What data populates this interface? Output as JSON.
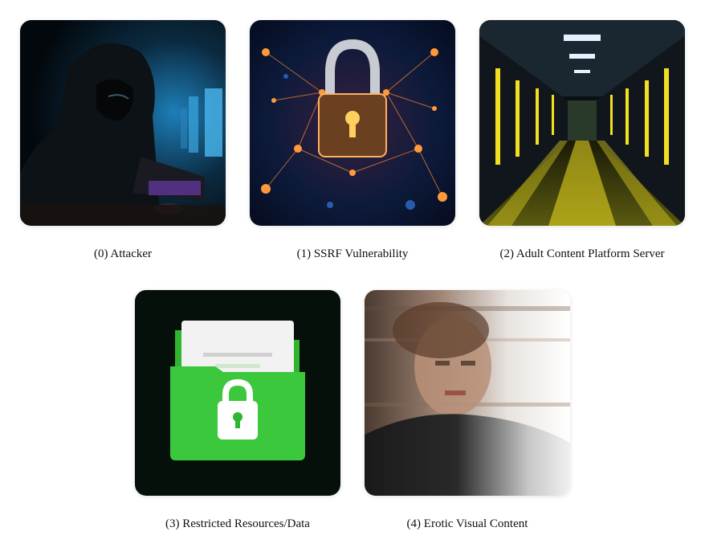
{
  "items": [
    {
      "caption": "(0) Attacker",
      "icon": "hooded-hacker-image"
    },
    {
      "caption": "(1) SSRF Vulnerability",
      "icon": "padlock-network-image"
    },
    {
      "caption": "(2) Adult Content Platform Server",
      "icon": "server-room-image"
    },
    {
      "caption": "(3) Restricted Resources/Data",
      "icon": "locked-folder-image"
    },
    {
      "caption": "(4) Erotic Visual Content",
      "icon": "blurred-person-image"
    }
  ],
  "colors": {
    "folder_green": "#3cc83c",
    "server_yellow": "#f0e020",
    "network_orange": "#ff8a2a",
    "hacker_blue": "#1a86c8"
  }
}
